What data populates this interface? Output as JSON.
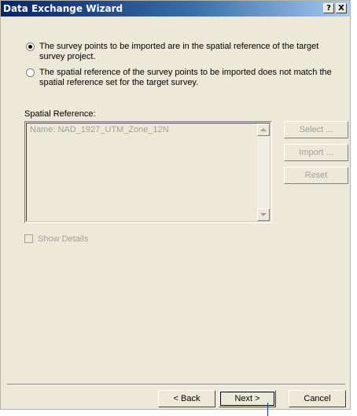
{
  "window": {
    "title": "Data Exchange Wizard",
    "help_label": "?",
    "close_label": "X"
  },
  "options": [
    {
      "label": "The survey points to be imported are in the spatial reference of the target survey project.",
      "checked": true
    },
    {
      "label": "The spatial reference of the survey points to be imported does not match the spatial reference set for the target survey.",
      "checked": false
    }
  ],
  "spatial_reference": {
    "label": "Spatial Reference:",
    "text": "Name: NAD_1927_UTM_Zone_12N"
  },
  "side_buttons": {
    "select": "Select ...",
    "import": "Import ...",
    "reset": "Reset"
  },
  "show_details": {
    "label": "Show Details",
    "checked": false
  },
  "footer": {
    "back": "< Back",
    "next": "Next >",
    "cancel": "Cancel"
  }
}
